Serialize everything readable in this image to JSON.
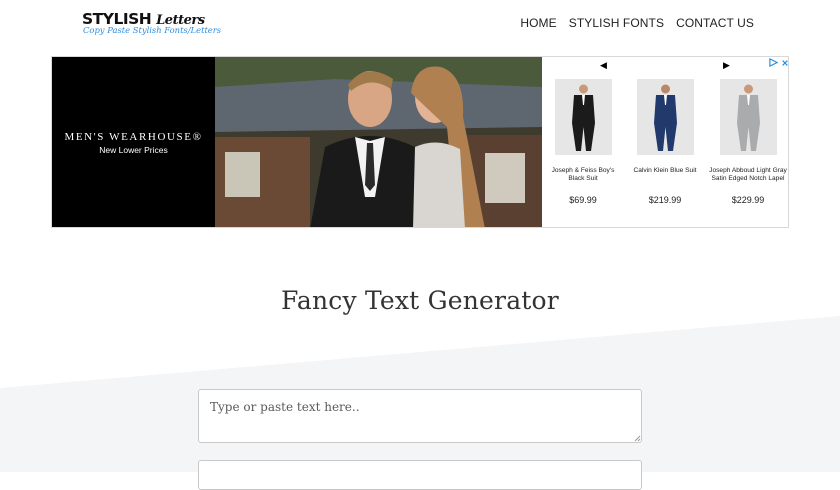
{
  "header": {
    "logo_main": "STYLISH",
    "logo_script": "Letters",
    "logo_tagline": "Copy Paste Stylish Fonts/Letters",
    "nav": [
      {
        "label": "HOME"
      },
      {
        "label": "STYLISH FONTS"
      },
      {
        "label": "CONTACT US"
      }
    ]
  },
  "ad": {
    "brand_name": "MEN'S WEARHOUSE®",
    "brand_tagline": "New Lower Prices",
    "prev_icon": "◀",
    "next_icon": "▶",
    "choices_icon": "adchoices-icon",
    "products": [
      {
        "name": "Joseph & Feiss Boy's Black Suit",
        "price": "$69.99",
        "suit_color": "#1b1b1b"
      },
      {
        "name": "Calvin Klein Blue Suit",
        "price": "$219.99",
        "suit_color": "#213a6b"
      },
      {
        "name": "Joseph Abboud Light Gray Satin Edged Notch Lapel",
        "price": "$229.99",
        "suit_color": "#a9abad"
      }
    ]
  },
  "main": {
    "title": "Fancy Text Generator",
    "input_placeholder": "Type or paste text here..",
    "input_value": ""
  },
  "colors": {
    "accent": "#2b8de0",
    "section_bg": "#f4f5f7"
  }
}
